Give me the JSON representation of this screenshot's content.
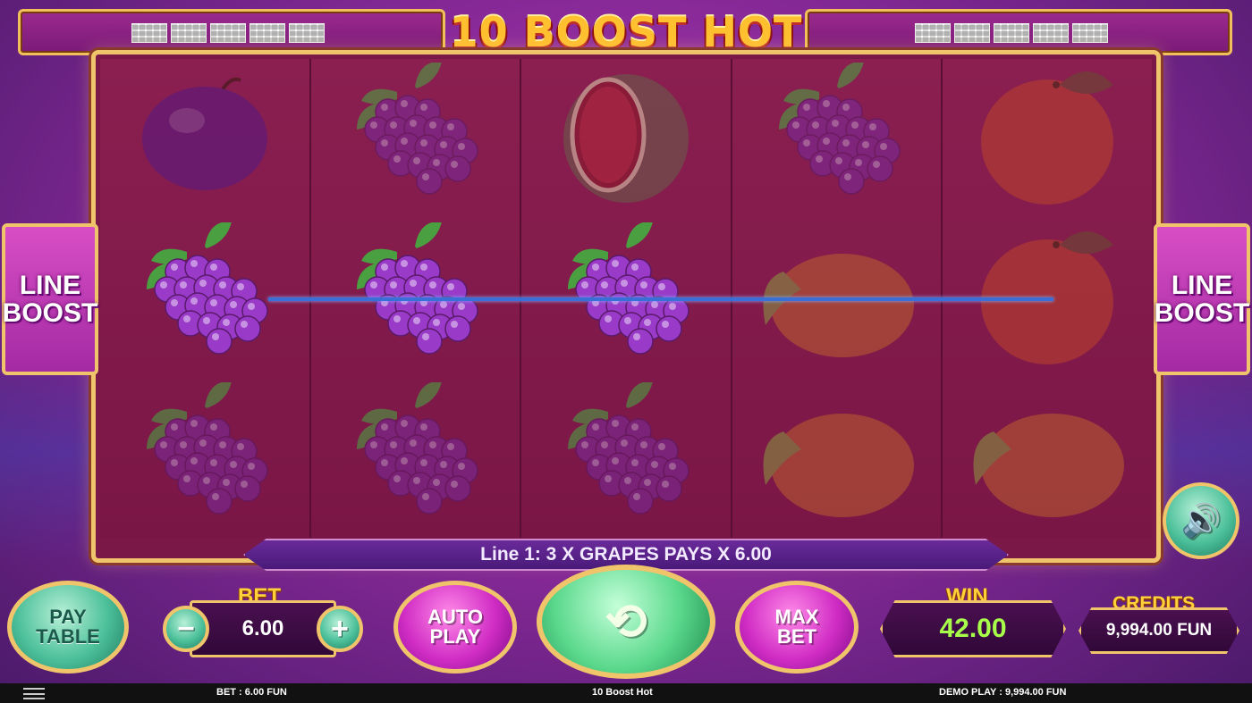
{
  "game": {
    "title": "10 BOOST HOT"
  },
  "side_buttons": {
    "left": {
      "line1": "LINE",
      "line2": "BOOST"
    },
    "right": {
      "line1": "LINE",
      "line2": "BOOST"
    }
  },
  "reels": [
    [
      "plum",
      "grapes",
      "grapes"
    ],
    [
      "grapes",
      "grapes",
      "grapes"
    ],
    [
      "watermelon",
      "grapes",
      "grapes"
    ],
    [
      "grapes",
      "lemon",
      "lemon"
    ],
    [
      "orange",
      "orange",
      "lemon"
    ]
  ],
  "winning_cells": [
    [
      0,
      1
    ],
    [
      1,
      1
    ],
    [
      2,
      1
    ]
  ],
  "win_message": "Line 1: 3 X GRAPES PAYS X 6.00",
  "controls": {
    "paytable_line1": "PAY",
    "paytable_line2": "TABLE",
    "bet_label": "BET",
    "bet_value": "6.00",
    "minus": "−",
    "plus": "+",
    "autoplay_line1": "AUTO",
    "autoplay_line2": "PLAY",
    "spin_symbol": "⟲",
    "maxbet_line1": "MAX",
    "maxbet_line2": "BET",
    "win_label": "WIN",
    "win_value": "42.00",
    "credits_label": "CREDITS",
    "credits_value": "9,994.00 FUN",
    "sound_symbol": "🔊"
  },
  "status_bar": {
    "bet": "BET : 6.00 FUN",
    "game_name": "10 Boost Hot",
    "demo": "DEMO PLAY : 9,994.00 FUN"
  },
  "icons": [
    "menu-icon",
    "sound-icon",
    "spin-icon"
  ],
  "colors": {
    "frame_gold": "#f0c46a",
    "reel_bg": "#7a1646",
    "payline": "#3b6fd8",
    "win_value": "#a8ff4a",
    "label_gold": "#ffd23a"
  }
}
